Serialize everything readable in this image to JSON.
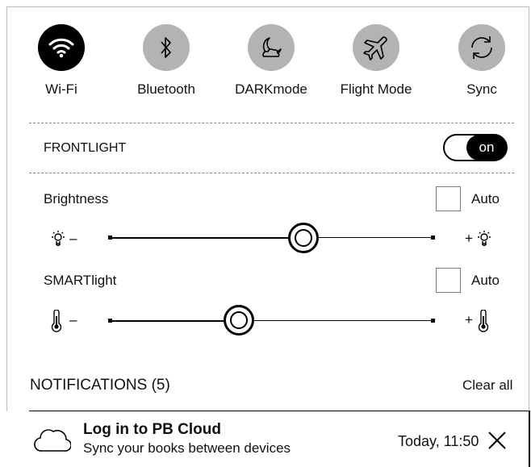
{
  "quick_buttons": [
    {
      "label": "Wi-Fi",
      "icon": "wifi-icon",
      "active": true
    },
    {
      "label": "Bluetooth",
      "icon": "bluetooth-icon",
      "active": false
    },
    {
      "label": "DARKmode",
      "icon": "moon-icon",
      "active": false
    },
    {
      "label": "Flight Mode",
      "icon": "airplane-icon",
      "active": false
    },
    {
      "label": "Sync",
      "icon": "sync-icon",
      "active": false
    }
  ],
  "frontlight": {
    "label": "FRONTLIGHT",
    "toggle_label": "on",
    "on": true
  },
  "brightness": {
    "label": "Brightness",
    "auto_label": "Auto",
    "auto_checked": false,
    "value_fraction": 0.6,
    "minus": "–",
    "plus": "+"
  },
  "smartlight": {
    "label": "SMARTlight",
    "auto_label": "Auto",
    "auto_checked": false,
    "value_fraction": 0.4,
    "minus": "–",
    "plus": "+"
  },
  "notifications": {
    "header": "NOTIFICATIONS (5)",
    "clear_all": "Clear all",
    "items": [
      {
        "title": "Log in to PB Cloud",
        "subtitle": "Sync your books between devices",
        "time": "Today, 11:50",
        "icon": "cloud-icon"
      }
    ]
  },
  "colors": {
    "active": "#000000",
    "inactive": "#b3b3b3",
    "background": "#ffffff"
  }
}
